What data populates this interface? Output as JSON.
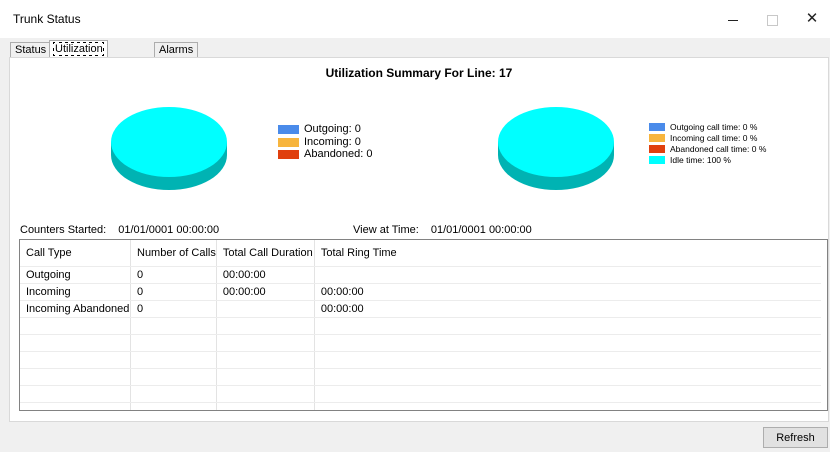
{
  "window": {
    "title": "Trunk Status",
    "controls": {
      "minimize": "minimize-icon",
      "maximize": "maximize-icon",
      "close": "close-icon"
    }
  },
  "tabs": [
    {
      "label": "Status",
      "selected": false
    },
    {
      "label": "Utilization Summary",
      "selected": true
    },
    {
      "label": "Alarms",
      "selected": false
    }
  ],
  "summary": {
    "heading": "Utilization Summary For Line: 17",
    "counters_label": "Counters Started:",
    "counters_value": "01/01/0001 00:00:00",
    "view_label": "View at Time:",
    "view_value": "01/01/0001 00:00:00"
  },
  "chart_data": [
    {
      "type": "pie",
      "series": [
        {
          "name": "Outgoing: 0",
          "value": 0,
          "color": "#4a8bea"
        },
        {
          "name": "Incoming: 0",
          "value": 0,
          "color": "#f7b53e"
        },
        {
          "name": "Abandoned: 0",
          "value": 0,
          "color": "#e0400e"
        }
      ],
      "pie_color": "#00ffff"
    },
    {
      "type": "pie",
      "series": [
        {
          "name": "Outgoing call time: 0 %",
          "value": 0,
          "color": "#4a8bea"
        },
        {
          "name": "Incoming call time: 0 %",
          "value": 0,
          "color": "#f7b53e"
        },
        {
          "name": "Abandoned call time: 0 %",
          "value": 0,
          "color": "#e0400e"
        },
        {
          "name": "Idle time: 100 %",
          "value": 100,
          "color": "#00ffff"
        }
      ],
      "pie_color": "#00ffff"
    }
  ],
  "grid": {
    "columns": [
      "Call Type",
      "Number of Calls",
      "Total Call Duration",
      "Total Ring Time"
    ],
    "rows": [
      [
        "Outgoing",
        "0",
        "00:00:00",
        ""
      ],
      [
        "Incoming",
        "0",
        "00:00:00",
        "00:00:00"
      ],
      [
        "Incoming Abandoned",
        "0",
        "",
        "00:00:00"
      ]
    ],
    "empty_rows": 6
  },
  "buttons": {
    "refresh": "Refresh"
  },
  "colors": {
    "pie_top": "#00ffff",
    "pie_side": "#00b3b3"
  }
}
